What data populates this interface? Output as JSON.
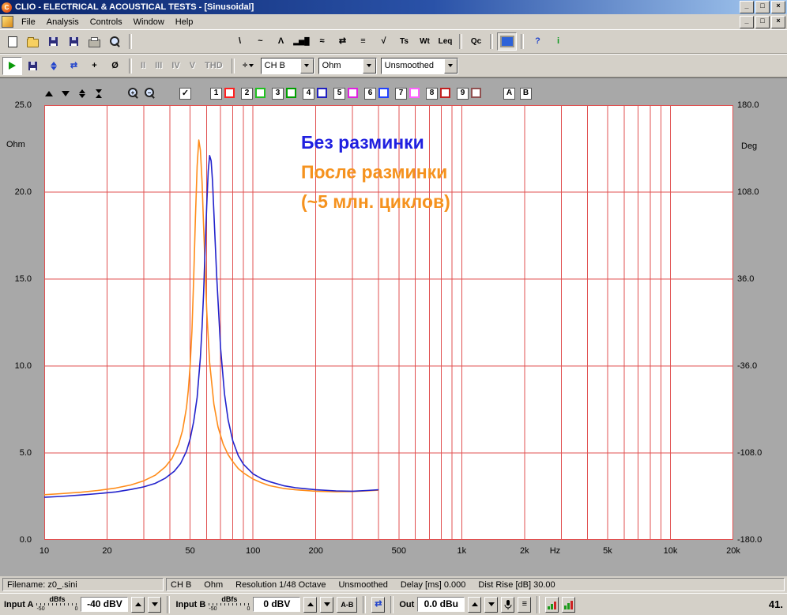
{
  "window": {
    "title": "CLIO - ELECTRICAL & ACOUSTICAL TESTS - [Sinusoidal]",
    "app_initial": "C"
  },
  "menu": {
    "items": [
      "File",
      "Analysis",
      "Controls",
      "Window",
      "Help"
    ]
  },
  "icons": {
    "minimize": "_",
    "maximize": "□",
    "close": "×",
    "mls": "\\",
    "sin": "~",
    "imp": "Λ",
    "bars": "▂▅█",
    "fft": "≈",
    "swap": "⇄",
    "lines": "≡",
    "sqrt": "√",
    "divide": "÷",
    "phi": "Ø",
    "help": "?",
    "about": "i",
    "check": "✓",
    "crosshair": "+"
  },
  "toolbar1": {
    "ts": "Ts",
    "wt": "Wt",
    "leq": "Leq",
    "qc": "Qc"
  },
  "toolbar2": {
    "disabled_items": [
      "II",
      "III",
      "IV",
      "V",
      "THD"
    ],
    "channel": "CH B",
    "unit": "Ohm",
    "smoothing": "Unsmoothed"
  },
  "graph_toolbar": {
    "curve_slots": [
      {
        "n": "1",
        "color": "#ff2020"
      },
      {
        "n": "2",
        "color": "#20c020"
      },
      {
        "n": "3",
        "color": "#00a000"
      },
      {
        "n": "4",
        "color": "#2020c0"
      },
      {
        "n": "5",
        "color": "#e020e0"
      },
      {
        "n": "6",
        "color": "#2040ff"
      },
      {
        "n": "7",
        "color": "#ff60ff"
      },
      {
        "n": "8",
        "color": "#c02020"
      },
      {
        "n": "9",
        "color": "#905050"
      }
    ],
    "ab": [
      "A",
      "B"
    ]
  },
  "chart_data": {
    "type": "line",
    "grid_color": "#e05050",
    "x_axis": {
      "scale": "log",
      "min": 10,
      "max": 20000,
      "unit": "Hz",
      "unit_x": 2800,
      "tick_freqs": [
        10,
        20,
        50,
        100,
        200,
        500,
        1000,
        2000,
        5000,
        10000,
        20000
      ],
      "tick_labels": [
        "10",
        "20",
        "50",
        "100",
        "200",
        "500",
        "1k",
        "2k",
        "5k",
        "10k",
        "20k"
      ]
    },
    "y_left": {
      "label": "Ohm",
      "min": 0,
      "max": 25,
      "ticks": [
        25,
        20,
        15,
        10,
        5,
        0
      ]
    },
    "y_right": {
      "label": "Deg",
      "min": -180,
      "max": 180,
      "ticks": [
        180,
        108,
        36,
        -36,
        -108,
        -180
      ]
    },
    "series": [
      {
        "name": "После разминки (~5 млн. циклов)",
        "color": "#ff8c1a",
        "x": [
          10,
          12,
          15,
          18,
          22,
          26,
          30,
          34,
          38,
          41,
          44,
          46,
          48,
          49,
          50,
          51,
          52,
          53,
          54,
          55,
          56,
          57,
          58,
          60,
          62,
          65,
          68,
          72,
          76,
          80,
          85,
          90,
          100,
          110,
          120,
          140,
          160,
          200,
          250,
          300,
          350,
          400
        ],
        "y": [
          2.6,
          2.66,
          2.74,
          2.84,
          2.98,
          3.16,
          3.4,
          3.72,
          4.2,
          4.7,
          5.5,
          6.3,
          7.6,
          8.6,
          10.0,
          12.0,
          15.0,
          18.5,
          21.5,
          23.0,
          22.4,
          20.6,
          18.0,
          13.2,
          10.2,
          7.8,
          6.5,
          5.5,
          4.9,
          4.5,
          4.1,
          3.85,
          3.5,
          3.28,
          3.12,
          2.96,
          2.88,
          2.8,
          2.77,
          2.78,
          2.82,
          2.86
        ]
      },
      {
        "name": "Без разминки",
        "color": "#2222cc",
        "x": [
          10,
          12,
          15,
          18,
          22,
          26,
          30,
          34,
          38,
          42,
          45,
          48,
          50,
          52,
          54,
          56,
          57,
          58,
          59,
          60,
          61,
          62,
          63,
          64,
          65,
          67,
          70,
          73,
          76,
          80,
          85,
          90,
          100,
          110,
          120,
          140,
          160,
          200,
          250,
          300,
          350,
          400
        ],
        "y": [
          2.45,
          2.5,
          2.58,
          2.66,
          2.76,
          2.9,
          3.05,
          3.25,
          3.55,
          3.95,
          4.4,
          5.1,
          5.8,
          6.8,
          8.2,
          10.5,
          12.2,
          14.2,
          16.8,
          19.2,
          21.2,
          22.1,
          21.8,
          20.6,
          18.8,
          15.2,
          11.0,
          8.4,
          6.9,
          5.7,
          4.85,
          4.35,
          3.8,
          3.52,
          3.35,
          3.12,
          3.0,
          2.88,
          2.82,
          2.8,
          2.84,
          2.88
        ]
      }
    ],
    "annotations": [
      {
        "text": "Без разминки",
        "color": "#2020e0",
        "x_hz": 170,
        "y_ohm": 22.5
      },
      {
        "text": "После разминки",
        "color": "#f5921e",
        "x_hz": 170,
        "y_ohm": 20.8
      },
      {
        "text": "(~5 млн. циклов)",
        "color": "#f5921e",
        "x_hz": 170,
        "y_ohm": 19.1
      }
    ]
  },
  "statusbar": {
    "filename": "Filename: z0_.sini",
    "info_parts": [
      "CH B",
      "Ohm",
      "Resolution 1/48 Octave",
      "Unsmoothed",
      "Delay [ms] 0.000",
      "Dist Rise [dB] 30.00"
    ]
  },
  "bottombar": {
    "input_a_label": "Input A",
    "input_b_label": "Input B",
    "meter_unit": "dBfs",
    "meter_min": "-50",
    "meter_max": "0",
    "input_a_value": "-40 dBV",
    "input_b_value": "0 dBV",
    "ab_button": "A-B",
    "out_label": "Out",
    "out_value": "0.0 dBu",
    "right_value": "41."
  }
}
